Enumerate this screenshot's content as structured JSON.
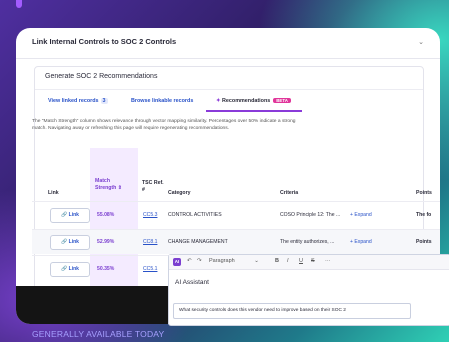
{
  "header": {
    "title": "Link Internal Controls to SOC 2 Controls",
    "collapse_icon": "chevron-down-icon"
  },
  "section": {
    "title": "Generate SOC 2 Recommendations"
  },
  "tabs": [
    {
      "label": "View linked records",
      "count": "3"
    },
    {
      "label": "Browse linkable records"
    },
    {
      "label": "Recommendations",
      "badge": "BETA",
      "icon": "sparkle-icon"
    }
  ],
  "description": "The \"Match Strength\" column shows relevance through vector mapping similarity. Percentages over 50% indicate a strong match. Navigating away or refreshing this page will require regenerating recommendations.",
  "table": {
    "columns": {
      "link": "Link",
      "match": "Match Strength",
      "tsc": "TSC Ref. #",
      "category": "Category",
      "criteria": "Criteria",
      "points": "Points"
    },
    "rows": [
      {
        "link": "Link",
        "match": "55.08%",
        "tsc": "CC5.3",
        "category": "CONTROL ACTIVITIES",
        "criteria": "COSO Principle 12: The ...",
        "expand": "+ Expand",
        "points": "The fo"
      },
      {
        "link": "Link",
        "match": "52.99%",
        "tsc": "CC8.1",
        "category": "CHANGE MANAGEMENT",
        "criteria": "The entity authorizes, ...",
        "expand": "+ Expand",
        "points": "Points"
      },
      {
        "link": "Link",
        "match": "50.35%",
        "tsc": "CC5.1",
        "category": "",
        "criteria": "",
        "expand": "",
        "points": ""
      }
    ]
  },
  "editor": {
    "badge": "AI",
    "paragraph_label": "Paragraph",
    "bold": "B",
    "italic": "I",
    "underline": "U",
    "strike": "S",
    "more": "···",
    "undo": "↶",
    "redo": "↷",
    "title": "AI Assistant",
    "prompt": "What security controls does this vendor need to improve based on their SOC 2"
  },
  "footer": "GENERALLY AVAILABLE TODAY",
  "colors": {
    "accent": "#7b3fd0",
    "link": "#2952c8",
    "beta": "#e0359a"
  }
}
